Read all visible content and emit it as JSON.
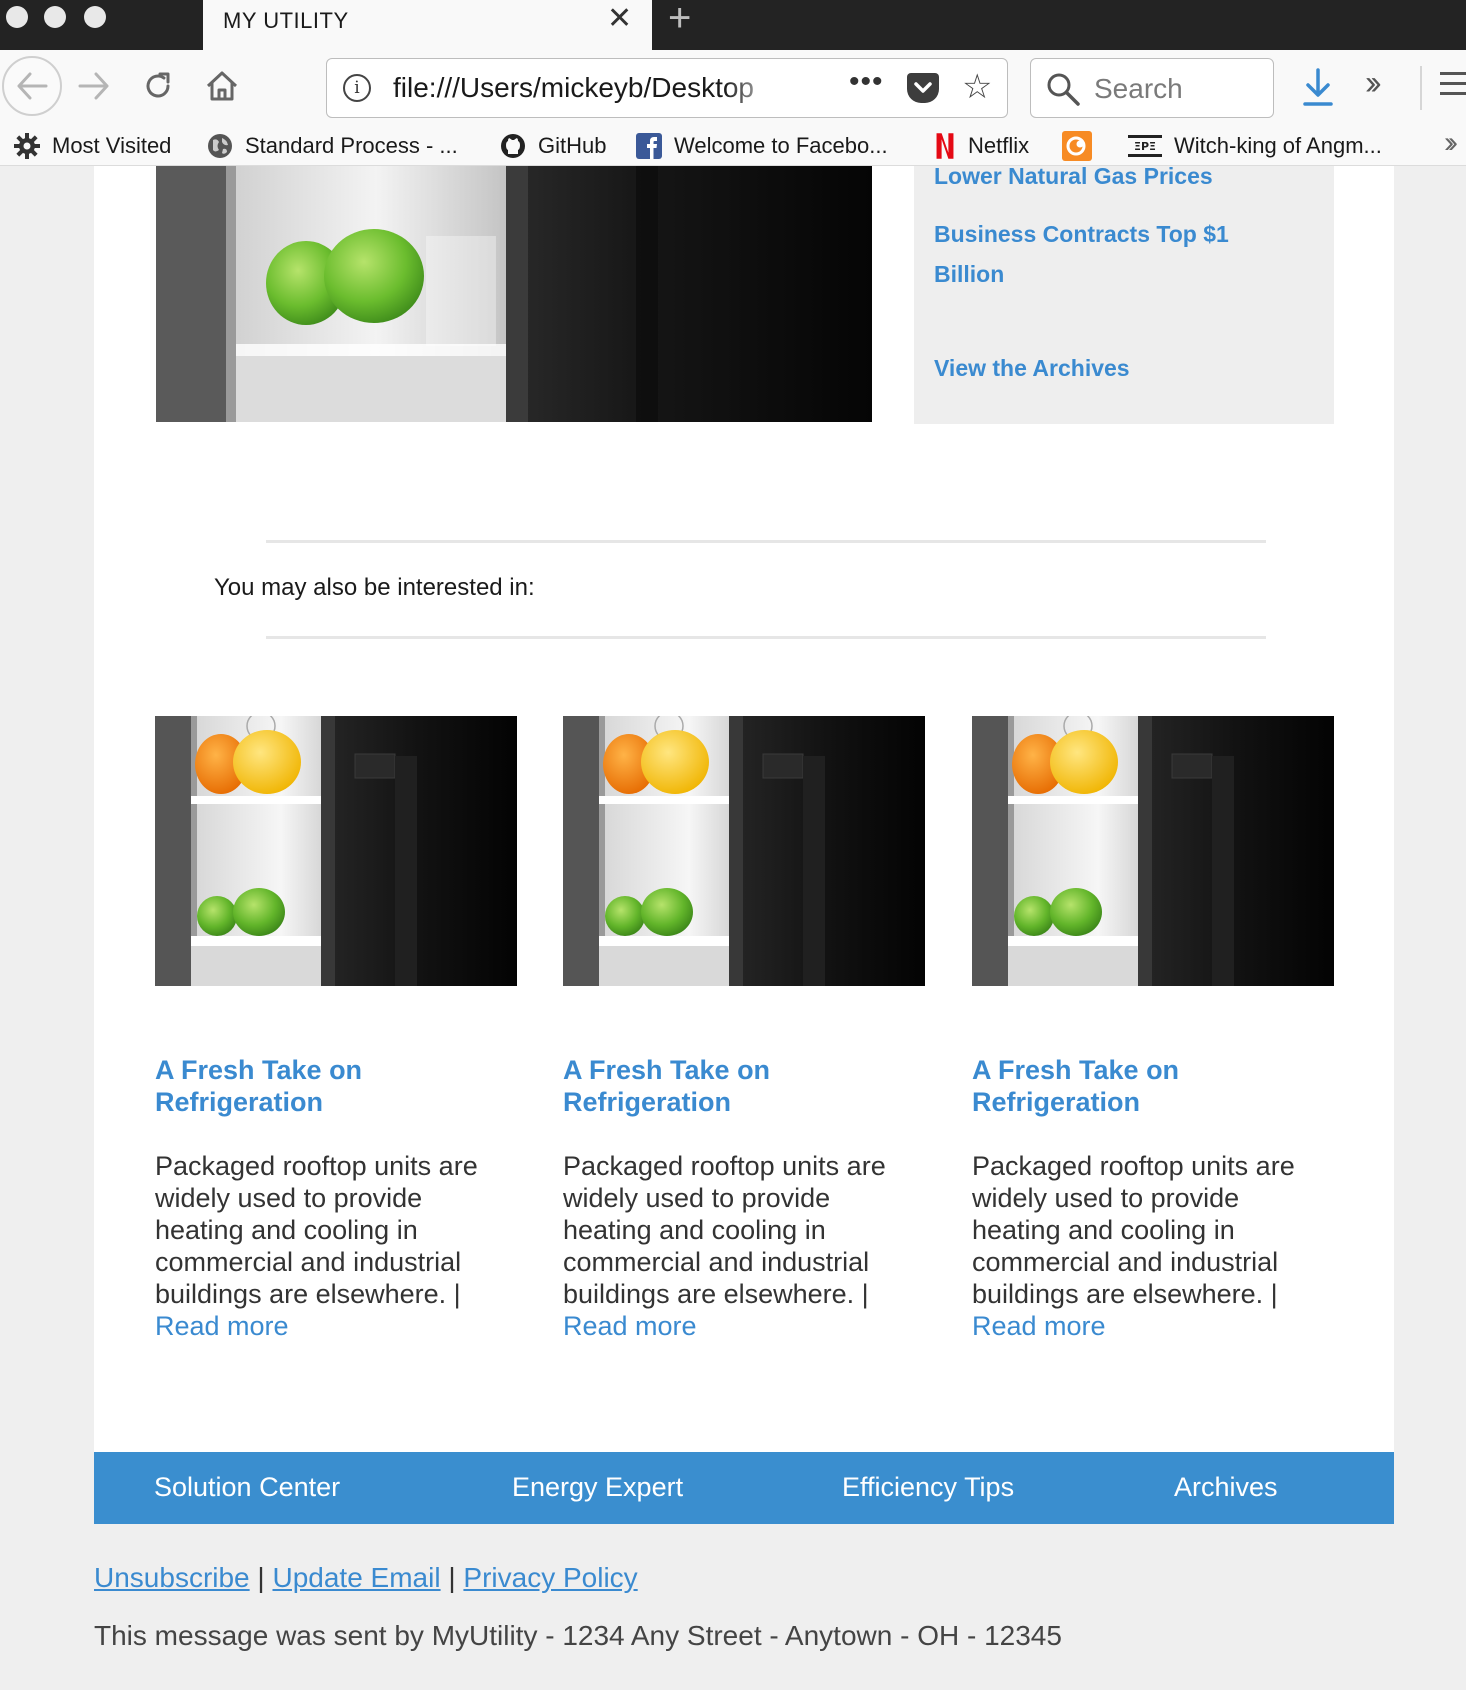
{
  "browser": {
    "tab_title": "MY UTILITY",
    "url": "file:///Users/mickeyb/Desktop",
    "search_placeholder": "Search",
    "bookmarks": [
      {
        "label": "Most Visited",
        "icon": "gear-icon"
      },
      {
        "label": "Standard Process - ...",
        "icon": "globe-icon"
      },
      {
        "label": "GitHub",
        "icon": "github-icon"
      },
      {
        "label": "Welcome to Facebo...",
        "icon": "facebook-icon"
      },
      {
        "label": "Netflix",
        "icon": "netflix-icon"
      },
      {
        "label": "",
        "icon": "crunchyroll-icon"
      },
      {
        "label": "Witch-king of Angm...",
        "icon": "site-icon"
      }
    ]
  },
  "sidebar": {
    "links": [
      "Lower Natural Gas Prices",
      "Business Contracts Top $1 Billion",
      "View the Archives"
    ]
  },
  "interest": {
    "heading": "You may also be interested in:"
  },
  "cards": [
    {
      "title": "A Fresh Take on Refrigeration",
      "body": "Packaged rooftop units are widely used to provide heating and cooling in commercial and industrial buildings are elsewhere. |",
      "link": "Read more"
    },
    {
      "title": "A Fresh Take on Refrigeration",
      "body": "Packaged rooftop units are widely used to provide heating and cooling in commercial and industrial buildings are elsewhere. |",
      "link": "Read more"
    },
    {
      "title": "A Fresh Take on Refrigeration",
      "body": "Packaged rooftop units are widely used to provide heating and cooling in commercial and industrial buildings are elsewhere. |",
      "link": "Read more"
    }
  ],
  "footer_nav": [
    "Solution Center",
    "Energy Expert",
    "Efficiency Tips",
    "Archives"
  ],
  "footer_links": [
    "Unsubscribe",
    "Update Email",
    "Privacy Policy"
  ],
  "footer_separator": "|",
  "sender_text": "This message was sent by MyUtility - 1234 Any Street - Anytown - OH - 12345",
  "colors": {
    "link_blue": "#3a8ad0",
    "footer_blue": "#3a8ecf"
  }
}
